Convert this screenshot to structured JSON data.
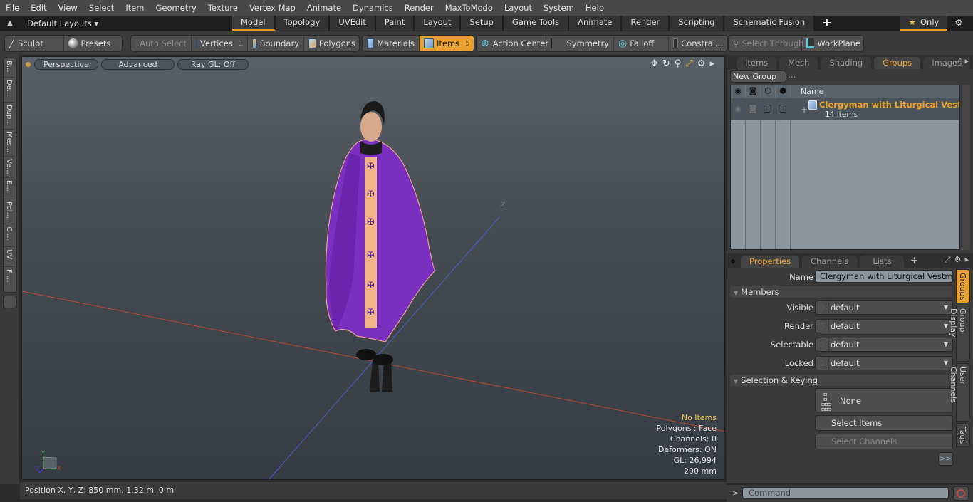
{
  "menu": [
    "File",
    "Edit",
    "View",
    "Select",
    "Item",
    "Geometry",
    "Texture",
    "Vertex Map",
    "Animate",
    "Dynamics",
    "Render",
    "MaxToModo",
    "Layout",
    "System",
    "Help"
  ],
  "layoutbar": {
    "default_layouts": "Default Layouts ▾",
    "tabs": [
      "Model",
      "Topology",
      "UVEdit",
      "Paint",
      "Layout",
      "Setup",
      "Game Tools",
      "Animate",
      "Render",
      "Scripting",
      "Schematic Fusion"
    ],
    "active_tab": "Model",
    "plus": "+",
    "only_label": "Only"
  },
  "toolbar": {
    "sculpt": "Sculpt",
    "presets": "Presets",
    "auto_select": "Auto Select",
    "vertices": "Vertices",
    "vertices_count": "1",
    "boundary": "Boundary",
    "polygons": "Polygons",
    "materials": "Materials",
    "items": "Items",
    "items_count": "5",
    "action_center": "Action Center",
    "symmetry": "Symmetry",
    "falloff": "Falloff",
    "constraints": "Constrai...",
    "select_through": "Select Through",
    "workplane": "WorkPlane"
  },
  "left_tabs": [
    "B...",
    "De...",
    "Dup...",
    "Mes...",
    "Ve...",
    "E...",
    "Pol...",
    "C ...",
    "UV",
    "F ..."
  ],
  "viewport": {
    "view_mode": "Perspective",
    "shading": "Advanced",
    "raygl": "Ray GL: Off",
    "axis_label_z": "Z",
    "info": {
      "selection": "No Items",
      "polygons": "Polygons : Face",
      "channels": "Channels: 0",
      "deformers": "Deformers: ON",
      "gl": "GL: 26,994",
      "scale": "200 mm"
    },
    "gizmo": {
      "y": "Y",
      "x": "X",
      "z": "Z"
    }
  },
  "status": {
    "position": "Position X, Y, Z:   850 mm, 1.32 m, 0 m"
  },
  "groups_panel": {
    "tabs": [
      "Items",
      "Mesh ...",
      "Shading",
      "Groups",
      "Images"
    ],
    "active_tab": "Groups",
    "new_group": "New Group",
    "name_header": "Name",
    "rows": [
      {
        "name": "Clergyman with Liturgical Vestm...",
        "count": "14 Items"
      }
    ]
  },
  "properties_panel": {
    "tabs": [
      "Properties",
      "Channels",
      "Lists"
    ],
    "active_tab": "Properties",
    "name_label": "Name",
    "name_value": "Clergyman with Liturgical Vestment Pu",
    "members_section": "Members",
    "fields": [
      {
        "label": "Visible",
        "value": "default"
      },
      {
        "label": "Render",
        "value": "default"
      },
      {
        "label": "Selectable",
        "value": "default"
      },
      {
        "label": "Locked",
        "value": "default"
      }
    ],
    "selection_section": "Selection & Keying",
    "none_label": "None",
    "select_items": "Select Items",
    "select_channels": "Select Channels",
    "more": ">>",
    "side_tabs": [
      "Groups",
      "Group Display",
      "User Channels",
      "Tags"
    ],
    "active_side_tab": "Groups"
  },
  "command": {
    "prompt": ">",
    "placeholder": "Command"
  },
  "colors": {
    "accent": "#e8a030",
    "robe": "#7a2fc0",
    "stole": "#f4b48a"
  }
}
